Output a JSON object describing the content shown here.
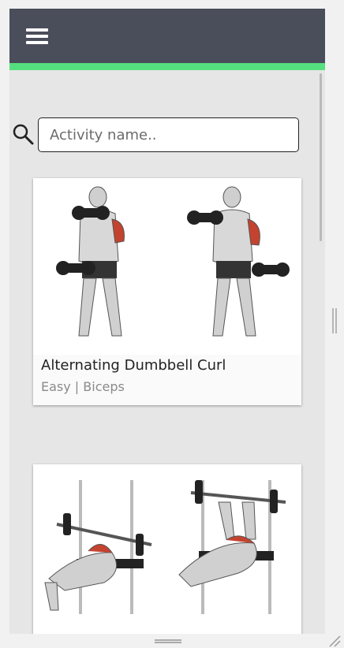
{
  "colors": {
    "header_bg": "#4a4e5b",
    "accent": "#55e07f",
    "content_bg": "#e6e6e6",
    "muscle_highlight": "#c4432f"
  },
  "header": {
    "menu_icon": "hamburger-icon"
  },
  "search": {
    "icon": "search-icon",
    "placeholder": "Activity name..",
    "value": ""
  },
  "activities": [
    {
      "title": "Alternating Dumbbell Curl",
      "meta": "Easy | Biceps",
      "illustration": "alternating-dumbbell-curl-illustration"
    },
    {
      "title": "",
      "meta": "",
      "illustration": "bench-press-illustration"
    }
  ]
}
